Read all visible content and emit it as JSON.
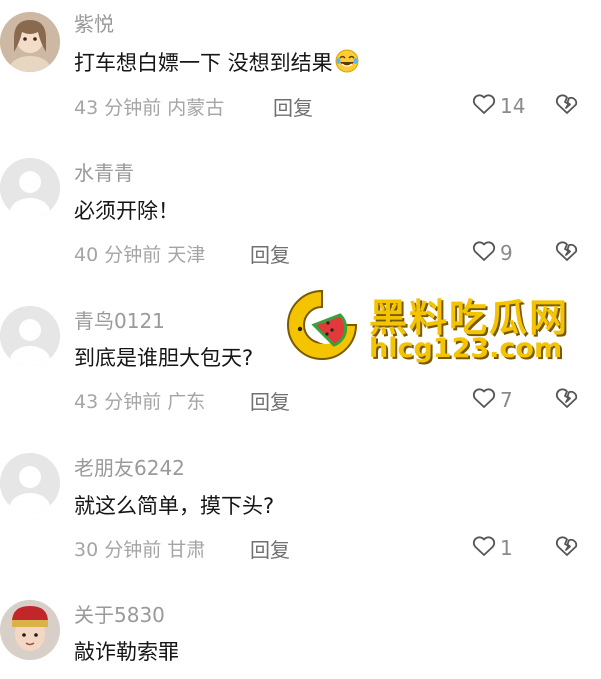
{
  "comments": [
    {
      "user": "紫悦",
      "text": "打车想白嫖一下 没想到结果",
      "time_location": "43 分钟前 内蒙古",
      "reply_label": "回复",
      "likes": "14",
      "avatar": "girl-avatar",
      "has_emoji": true
    },
    {
      "user": "水青青",
      "text": "必须开除！",
      "time_location": "40 分钟前 天津",
      "reply_label": "回复",
      "likes": "9",
      "avatar": "default-avatar"
    },
    {
      "user": "青鸟0121",
      "text": "到底是谁胆大包天?",
      "time_location": "43 分钟前 广东",
      "reply_label": "回复",
      "likes": "7",
      "avatar": "default-avatar"
    },
    {
      "user": "老朋友6242",
      "text": "就这么简单，摸下头?",
      "time_location": "30 分钟前 甘肃",
      "reply_label": "回复",
      "likes": "1",
      "avatar": "default-avatar"
    },
    {
      "user": "关于5830",
      "text": "敲诈勒索罪",
      "avatar": "boy-avatar"
    }
  ],
  "watermark": {
    "title": "黑料吃瓜网",
    "url": "hlcg123.com",
    "color": "#f5c400"
  },
  "icons": {
    "like": "heart-outline-icon",
    "dislike": "broken-heart-icon",
    "emoji": "laughing-tears-emoji"
  }
}
